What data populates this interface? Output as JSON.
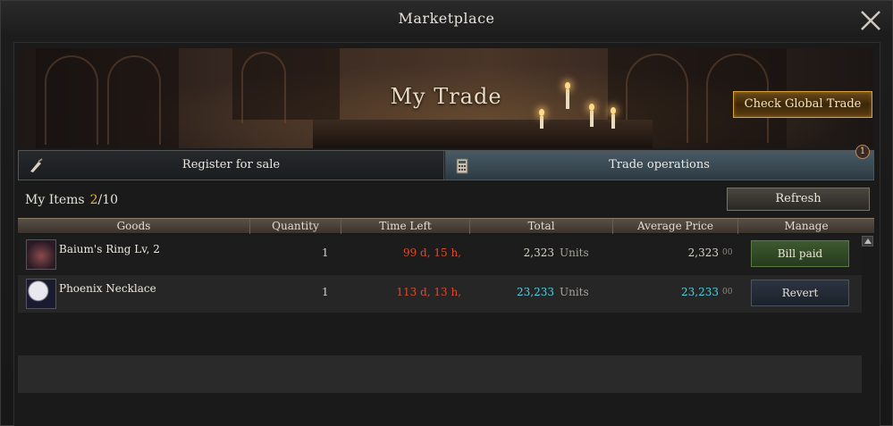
{
  "window": {
    "title": "Marketplace"
  },
  "banner": {
    "title": "My Trade",
    "global_button": "Check Global Trade"
  },
  "tabs": [
    {
      "label": "Register for sale",
      "icon": "quill-icon"
    },
    {
      "label": "Trade operations",
      "icon": "calculator-icon",
      "badge": "1"
    }
  ],
  "items_header": {
    "label": "My Items",
    "count": "2",
    "max": "/10"
  },
  "refresh_label": "Refresh",
  "table": {
    "columns": [
      "Goods",
      "Quantity",
      "Time Left",
      "Total",
      "Average Price",
      "Manage"
    ],
    "rows": [
      {
        "name": "Baium's Ring Lv, 2",
        "quantity": "1",
        "time_left": "99 d, 15 h,",
        "total": "2,323",
        "total_unit": "Units",
        "avg_price": "2,323",
        "avg_decimal": "00",
        "action": "Bill paid",
        "value_color": "#d8d4cc"
      },
      {
        "name": "Phoenix Necklace",
        "quantity": "1",
        "time_left": "113 d, 13 h,",
        "total": "23,233",
        "total_unit": "Units",
        "avg_price": "23,233",
        "avg_decimal": "00",
        "action": "Revert",
        "value_color": "#4ad0e0"
      }
    ]
  },
  "colors": {
    "time_left": "#e04a2a",
    "highlight_count": "#e8b840",
    "gold_button_border": "#d4a040"
  }
}
